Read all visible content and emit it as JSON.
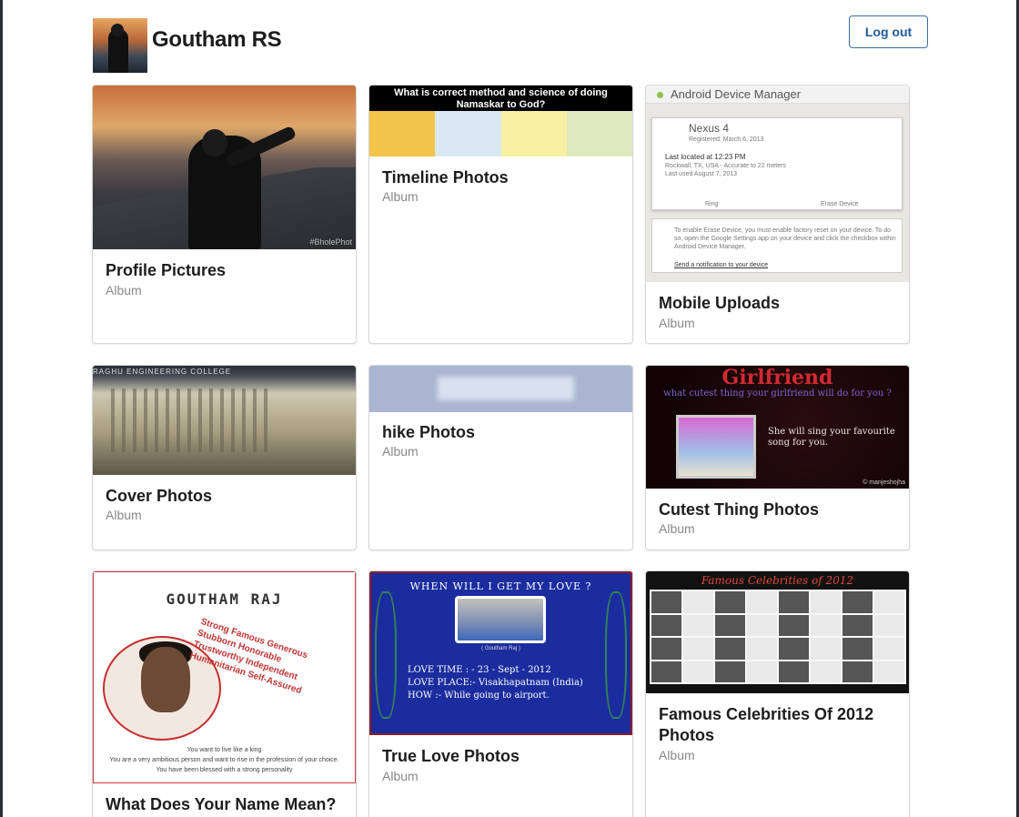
{
  "header": {
    "user_name": "Goutham RS",
    "logout_label": "Log out"
  },
  "albums": [
    {
      "title": "Profile Pictures",
      "subtitle": "Album",
      "thumb_watermark": "#BholePhot"
    },
    {
      "title": "Timeline Photos",
      "subtitle": "Album",
      "thumb_text": "What is correct method and science of doing Namaskar to God?"
    },
    {
      "title": "Mobile Uploads",
      "subtitle": "Album",
      "thumb_text": {
        "app": "Android Device Manager",
        "device": "Nexus 4",
        "registered": "Registered: March 6, 2013",
        "located": "Last located at 12:23 PM",
        "location": "Rockwall, TX, USA - Accurate to 22 meters",
        "last_used": "Last used August 7, 2013",
        "ring": "Ring",
        "erase": "Erase Device",
        "notice": "To enable Erase Device, you must enable factory reset on your device. To do so, open the Google Settings app on your device and click the checkbox within Android Device Manager.",
        "link": "Send a notification to your device"
      }
    },
    {
      "title": "Cover Photos",
      "subtitle": "Album",
      "thumb_text": "RAGHU ENGINEERING COLLEGE"
    },
    {
      "title": "hike Photos",
      "subtitle": "Album"
    },
    {
      "title": "Cutest Thing Photos",
      "subtitle": "Album",
      "thumb_text": {
        "headline": "Girlfriend",
        "question": "what cutest thing your girlfriend will do for you ?",
        "answer": "She will sing your favourite song for you.",
        "credit": "© manjeshojha"
      }
    },
    {
      "title": "What Does Your Name Mean?",
      "subtitle": "",
      "thumb_text": {
        "name": "GOUTHAM RAJ",
        "traits": "Strong Famous Generous Stubborn Honorable Trustworthy Independent Humanitarian Self-Assured",
        "line1": "You want to live like a king",
        "line2": "You are a very ambitious person and want to rise in the profession of your choice.",
        "line3": "You have been blessed with a strong personality"
      }
    },
    {
      "title": "True Love Photos",
      "subtitle": "Album",
      "thumb_text": {
        "headline": "WHEN  WILL I GET MY LOVE ?",
        "caption": "( Goutham Raj )",
        "time": "LOVE TIME : - 23 - Sept - 2012",
        "place": "LOVE PLACE:- Visakhapatnam    (India)",
        "how": "HOW :-  While going to airport."
      }
    },
    {
      "title": "Famous Celebrities Of 2012 Photos",
      "subtitle": "Album",
      "thumb_text": {
        "headline": "Famous Celebrities of 2012"
      }
    }
  ],
  "colors": {
    "accent": "#1f5a96",
    "card_border": "#d6d6d6",
    "subtitle": "#888888"
  }
}
